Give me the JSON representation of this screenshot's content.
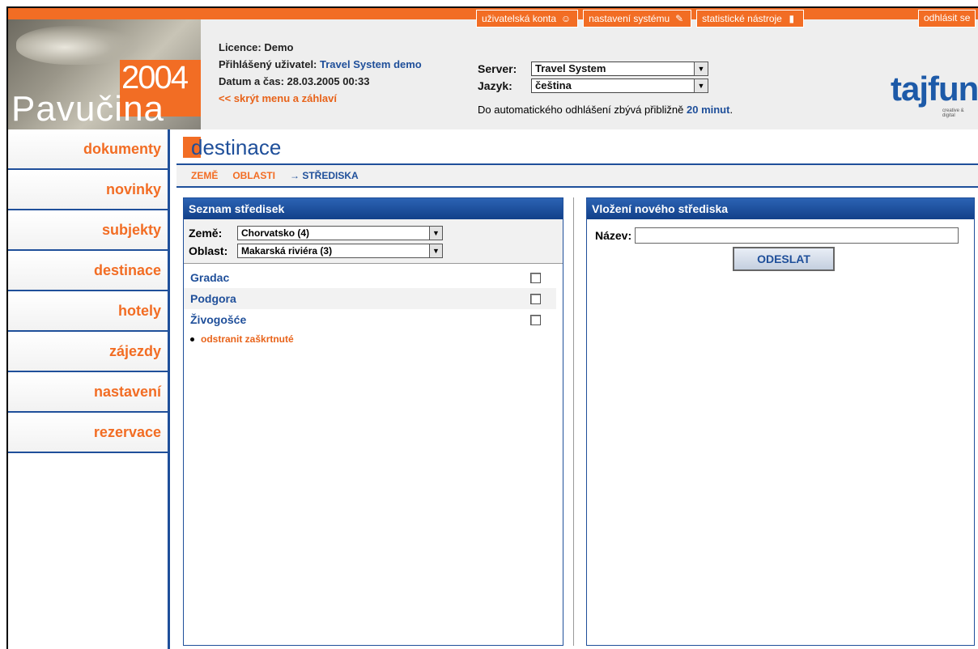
{
  "header": {
    "logo": {
      "year": "2004",
      "name": "Pavučina"
    },
    "info": {
      "license_label": "Licence:",
      "license_value": "Demo",
      "user_label": "Přihlášený uživatel:",
      "user_value": "Travel System demo",
      "datetime_label": "Datum a čas:",
      "datetime_value": "28.03.2005 00:33",
      "hide_link": "<< skrýt menu a záhlaví"
    },
    "top_menu": [
      {
        "label": "uživatelská konta",
        "icon": "users-icon"
      },
      {
        "label": "nastavení systému",
        "icon": "wrench-icon"
      },
      {
        "label": "statistické nástroje",
        "icon": "bar-chart-icon"
      }
    ],
    "logout": "odhlásit se",
    "server_label": "Server:",
    "server_value": "Travel System",
    "language_label": "Jazyk:",
    "language_value": "čeština",
    "autologout_text": "Do automatického odhlášení zbývá přibližně",
    "autologout_time": "20 minut",
    "autologout_end": ".",
    "brand": "tajfun",
    "brand_sub": "creative & digital"
  },
  "sidebar": {
    "items": [
      {
        "label": "dokumenty"
      },
      {
        "label": "novinky"
      },
      {
        "label": "subjekty"
      },
      {
        "label": "destinace"
      },
      {
        "label": "hotely"
      },
      {
        "label": "zájezdy"
      },
      {
        "label": "nastavení"
      },
      {
        "label": "rezervace"
      }
    ]
  },
  "main": {
    "title": "destinace",
    "breadcrumb": {
      "countries": "ZEMĚ",
      "regions": "OBLASTI",
      "current": "→ STŘEDISKA"
    },
    "left_panel": {
      "title": "Seznam středisek",
      "country_label": "Země:",
      "country_value": "Chorvatsko (4)",
      "region_label": "Oblast:",
      "region_value": "Makarská riviéra (3)",
      "resorts": [
        {
          "name": "Gradac",
          "checked": false
        },
        {
          "name": "Podgora",
          "checked": false
        },
        {
          "name": "Živogošće",
          "checked": false
        }
      ],
      "remove_label": "odstranit zaškrtnuté"
    },
    "right_panel": {
      "title": "Vložení nového střediska",
      "name_label": "Název:",
      "name_value": "",
      "submit_label": "ODESLAT"
    }
  },
  "colors": {
    "orange": "#f26d24",
    "blue": "#1f4f9a",
    "header_bg": "#eeeeee"
  }
}
